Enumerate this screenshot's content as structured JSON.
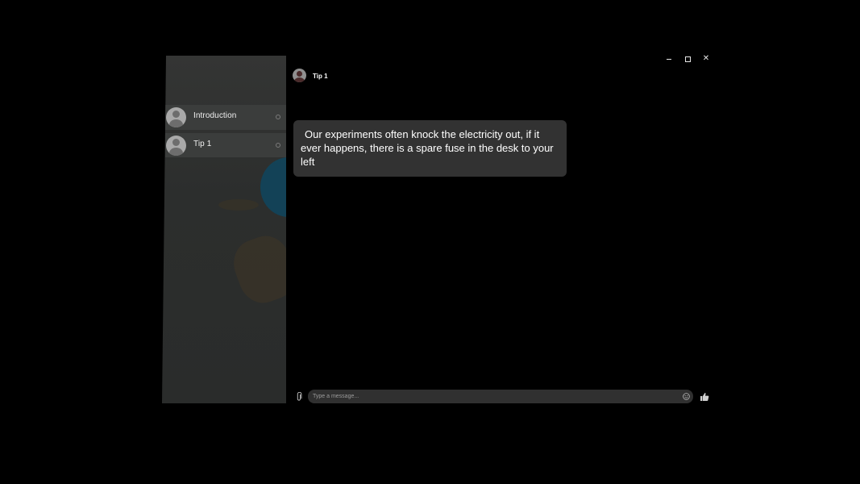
{
  "window": {
    "minimize_glyph": "–",
    "maximize_glyph": "□",
    "close_glyph": "✕"
  },
  "sidebar": {
    "items": [
      {
        "label": "Introduction",
        "icon": "avatar-icon",
        "status_icon": "status-circle-icon"
      },
      {
        "label": "Tip 1",
        "icon": "avatar-icon",
        "status_icon": "status-circle-icon"
      }
    ]
  },
  "chat": {
    "title": "Tip 1",
    "messages": [
      {
        "text": "Our experiments often knock the electricity out, if it ever happens, there is a spare fuse in the desk to your left"
      }
    ]
  },
  "composer": {
    "placeholder": "Type a message...",
    "value": "",
    "attach_icon": "paperclip-icon",
    "emoji_icon": "smiley-icon",
    "send_icon": "thumbs-up-icon"
  },
  "colors": {
    "background": "#000000",
    "sidebar": "#2c2e2d",
    "item_highlight": "#3b3d3c",
    "bubble": "#323232",
    "composer": "#303030",
    "text": "#ffffff"
  }
}
